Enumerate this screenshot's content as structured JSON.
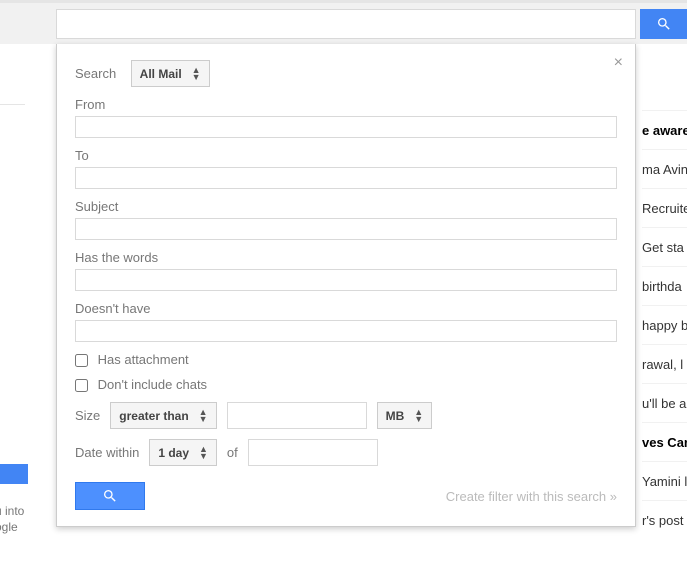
{
  "panel": {
    "search_label": "Search",
    "scope": "All Mail",
    "from_label": "From",
    "to_label": "To",
    "subject_label": "Subject",
    "haswords_label": "Has the words",
    "doesnthave_label": "Doesn't have",
    "has_attachment": "Has attachment",
    "dont_include_chats": "Don't include chats",
    "size_label": "Size",
    "size_op": "greater than",
    "size_unit": "MB",
    "date_label": "Date within",
    "date_range": "1 day",
    "date_of": "of",
    "filter_link": "Create filter with this search »"
  },
  "left": {
    "t1": "u into",
    "t2": "ogle"
  },
  "right": [
    {
      "text": "e aware",
      "bold": true
    },
    {
      "text": "ma Avin",
      "bold": false
    },
    {
      "text": "Recruite",
      "bold": false
    },
    {
      "text": "Get sta",
      "bold": false
    },
    {
      "text": "birthda",
      "bold": false
    },
    {
      "text": "happy b",
      "bold": false
    },
    {
      "text": "rawal, l",
      "bold": false
    },
    {
      "text": "u'll be a",
      "bold": false
    },
    {
      "text": "ves Car",
      "bold": true
    },
    {
      "text": "Yamini l",
      "bold": false
    },
    {
      "text": "r's post",
      "bold": false
    }
  ]
}
